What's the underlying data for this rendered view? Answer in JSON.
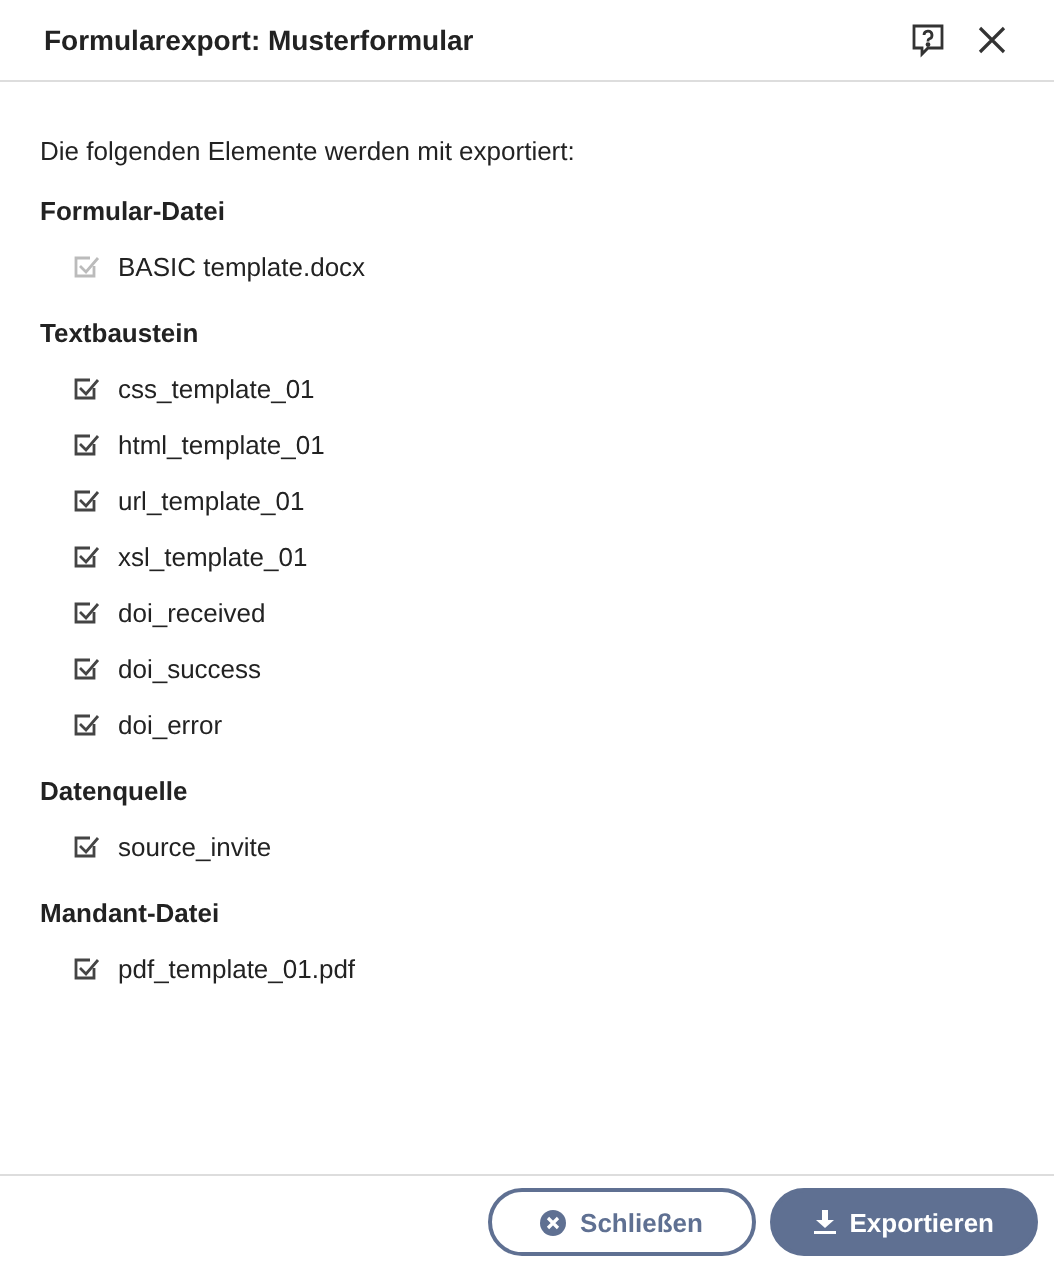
{
  "dialog": {
    "title": "Formularexport: Musterformular"
  },
  "intro": "Die folgenden Elemente werden mit exportiert:",
  "sections": [
    {
      "heading": "Formular-Datei",
      "items": [
        {
          "label": "BASIC template.docx",
          "checked": true,
          "disabled": true
        }
      ]
    },
    {
      "heading": "Textbaustein",
      "items": [
        {
          "label": "css_template_01",
          "checked": true,
          "disabled": false
        },
        {
          "label": "html_template_01",
          "checked": true,
          "disabled": false
        },
        {
          "label": "url_template_01",
          "checked": true,
          "disabled": false
        },
        {
          "label": "xsl_template_01",
          "checked": true,
          "disabled": false
        },
        {
          "label": "doi_received",
          "checked": true,
          "disabled": false
        },
        {
          "label": "doi_success",
          "checked": true,
          "disabled": false
        },
        {
          "label": "doi_error",
          "checked": true,
          "disabled": false
        }
      ]
    },
    {
      "heading": "Datenquelle",
      "items": [
        {
          "label": "source_invite",
          "checked": true,
          "disabled": false
        }
      ]
    },
    {
      "heading": "Mandant-Datei",
      "items": [
        {
          "label": "pdf_template_01.pdf",
          "checked": true,
          "disabled": false
        }
      ]
    }
  ],
  "buttons": [
    {
      "label": "Schließen",
      "kind": "secondary"
    },
    {
      "label": "Exportieren",
      "kind": "primary"
    }
  ]
}
